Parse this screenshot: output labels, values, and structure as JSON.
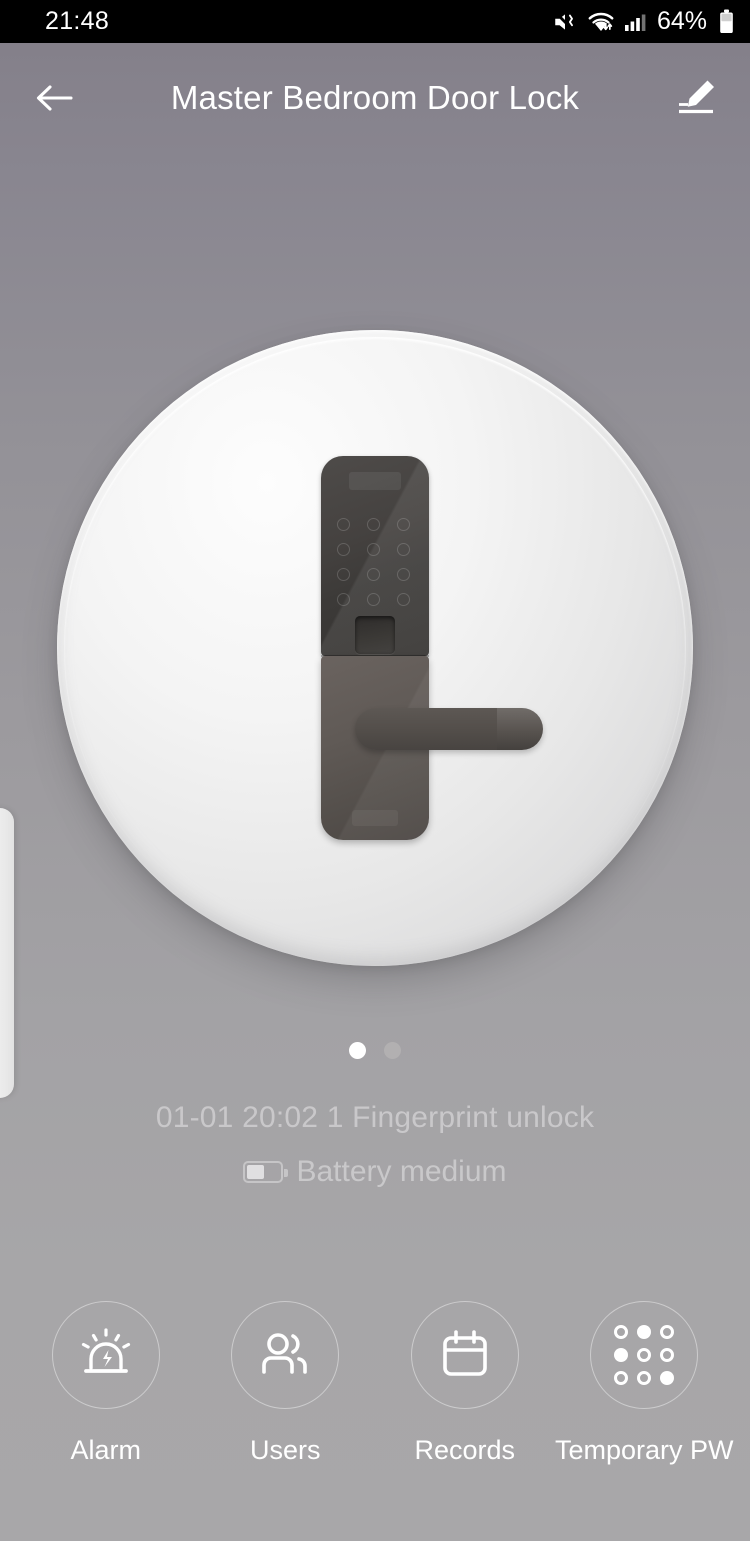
{
  "statusbar": {
    "time": "21:48",
    "battery_percent": "64%",
    "icons": [
      "mute-vibrate-icon",
      "wifi-icon",
      "cellular-signal-icon",
      "battery-icon"
    ]
  },
  "header": {
    "title": "Master Bedroom Door Lock",
    "back_icon": "arrow-left-icon",
    "edit_icon": "edit-pencil-icon"
  },
  "device": {
    "illustration": "smart-door-lock-image",
    "keypad_dot_count": 12
  },
  "carousel": {
    "pages": 2,
    "active_index": 0
  },
  "status": {
    "last_event": "01-01 20:02 1 Fingerprint unlock",
    "battery_label": "Battery medium",
    "battery_icon": "battery-half-icon"
  },
  "actions": [
    {
      "label": "Alarm",
      "icon": "siren-alarm-icon"
    },
    {
      "label": "Users",
      "icon": "users-icon"
    },
    {
      "label": "Records",
      "icon": "calendar-records-icon"
    },
    {
      "label": "Temporary PW",
      "icon": "keypad-dots-icon"
    }
  ],
  "keypad_icon_pattern": [
    "ring",
    "solid",
    "ring",
    "solid",
    "ring",
    "ring",
    "ring",
    "ring",
    "solid"
  ],
  "colors": {
    "statusbar_bg": "#000000",
    "background_top": "#84808a",
    "background_bottom": "#a8a7a9",
    "text_primary": "#ffffff",
    "text_muted": "#c9c8ca",
    "dot_active": "#ffffff",
    "dot_idle": "#b2b0b1"
  },
  "drawer": {
    "handle": "left-drawer-handle"
  }
}
